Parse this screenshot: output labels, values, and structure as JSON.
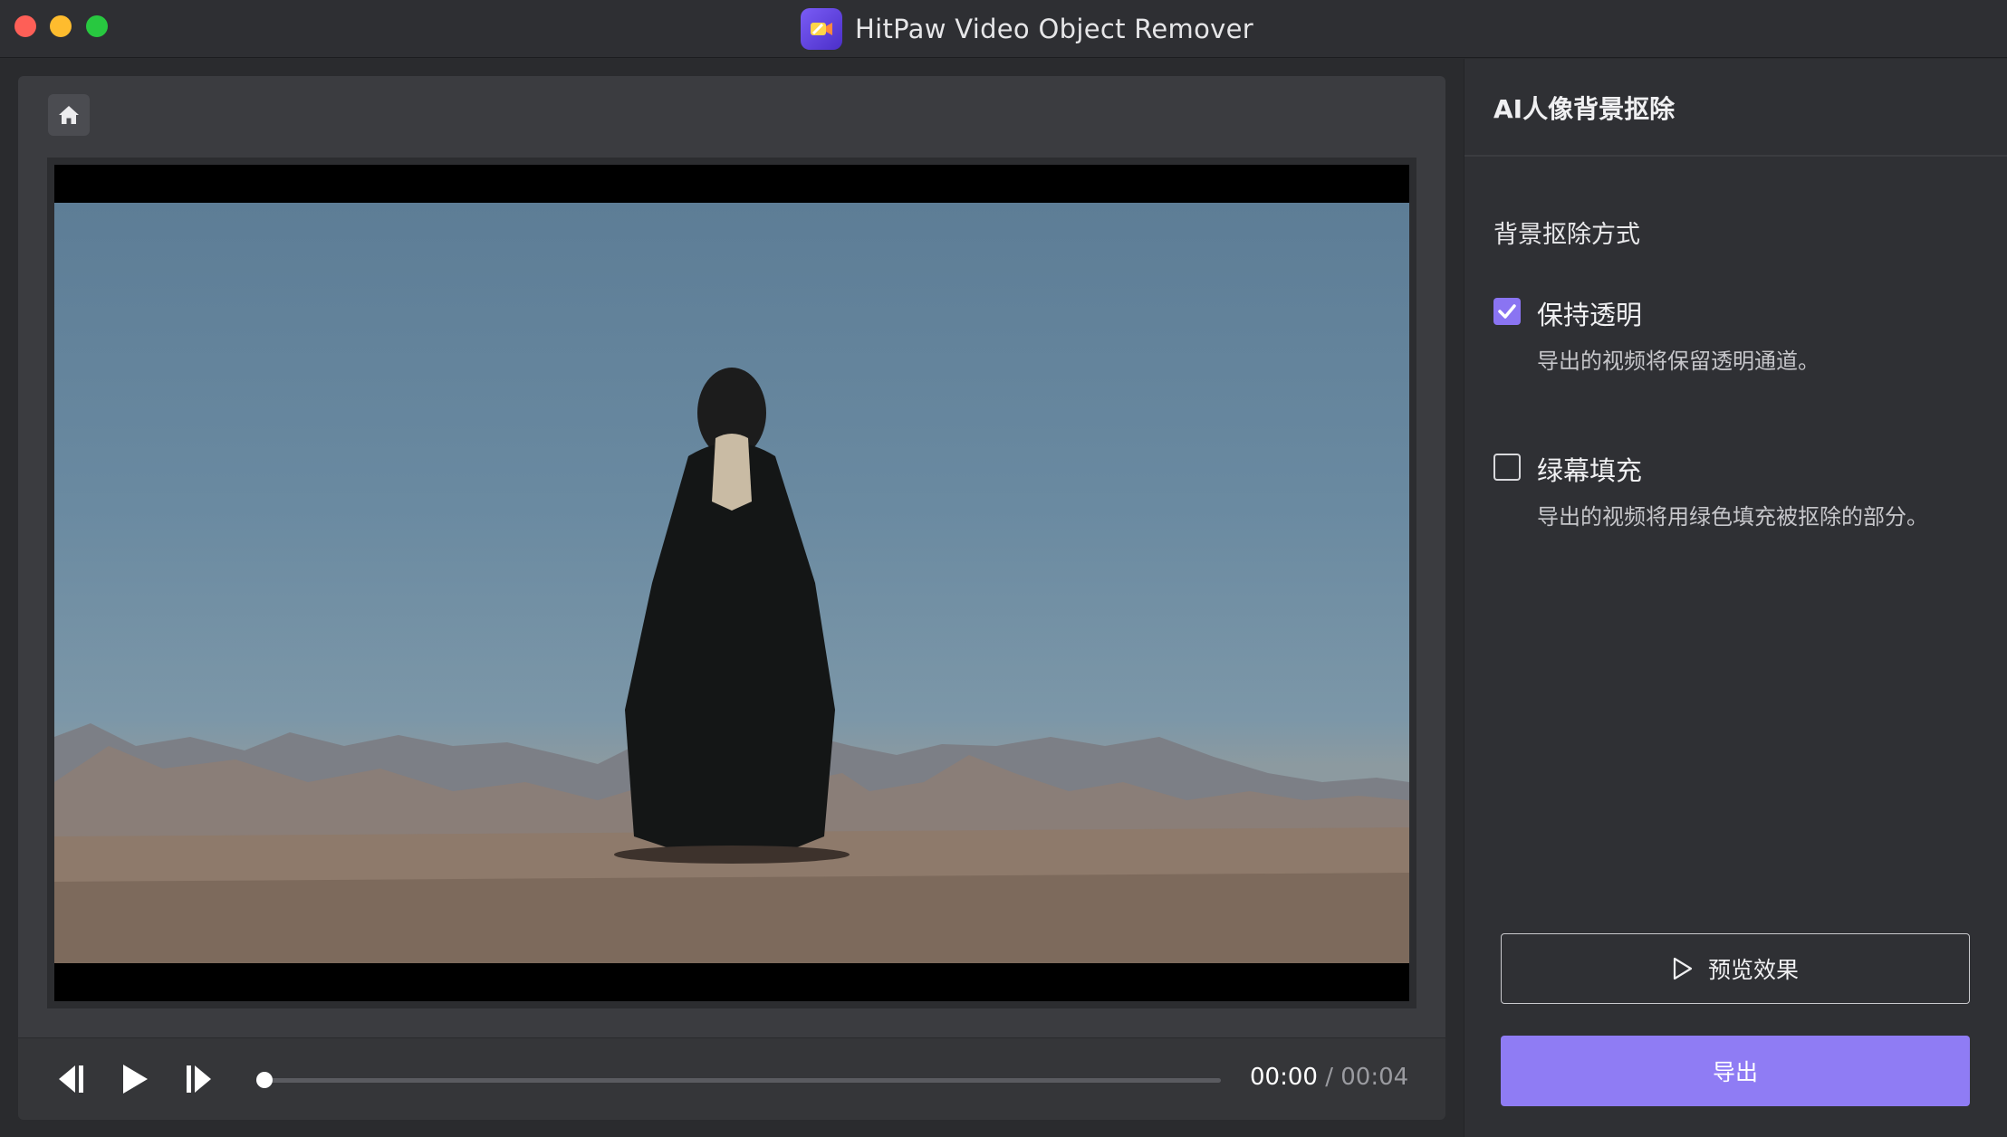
{
  "window": {
    "title": "HitPaw Video Object Remover"
  },
  "player": {
    "current_time": "00:00",
    "separator": " / ",
    "duration": "00:04",
    "progress": 0
  },
  "panel": {
    "title": "AI人像背景抠除",
    "section_label": "背景抠除方式",
    "options": [
      {
        "label": "保持透明",
        "description": "导出的视频将保留透明通道。",
        "checked": true
      },
      {
        "label": "绿幕填充",
        "description": "导出的视频将用绿色填充被抠除的部分。",
        "checked": false
      }
    ],
    "preview_label": "预览效果",
    "export_label": "导出"
  },
  "colors": {
    "accent": "#8f7cf4",
    "checkbox_on": "#8a74f2",
    "close": "#fe5f57",
    "minimize": "#febc2e",
    "maximize": "#28c840"
  },
  "icons": [
    "home-icon",
    "step-back-icon",
    "play-icon",
    "step-forward-icon",
    "check-icon",
    "preview-play-icon"
  ]
}
